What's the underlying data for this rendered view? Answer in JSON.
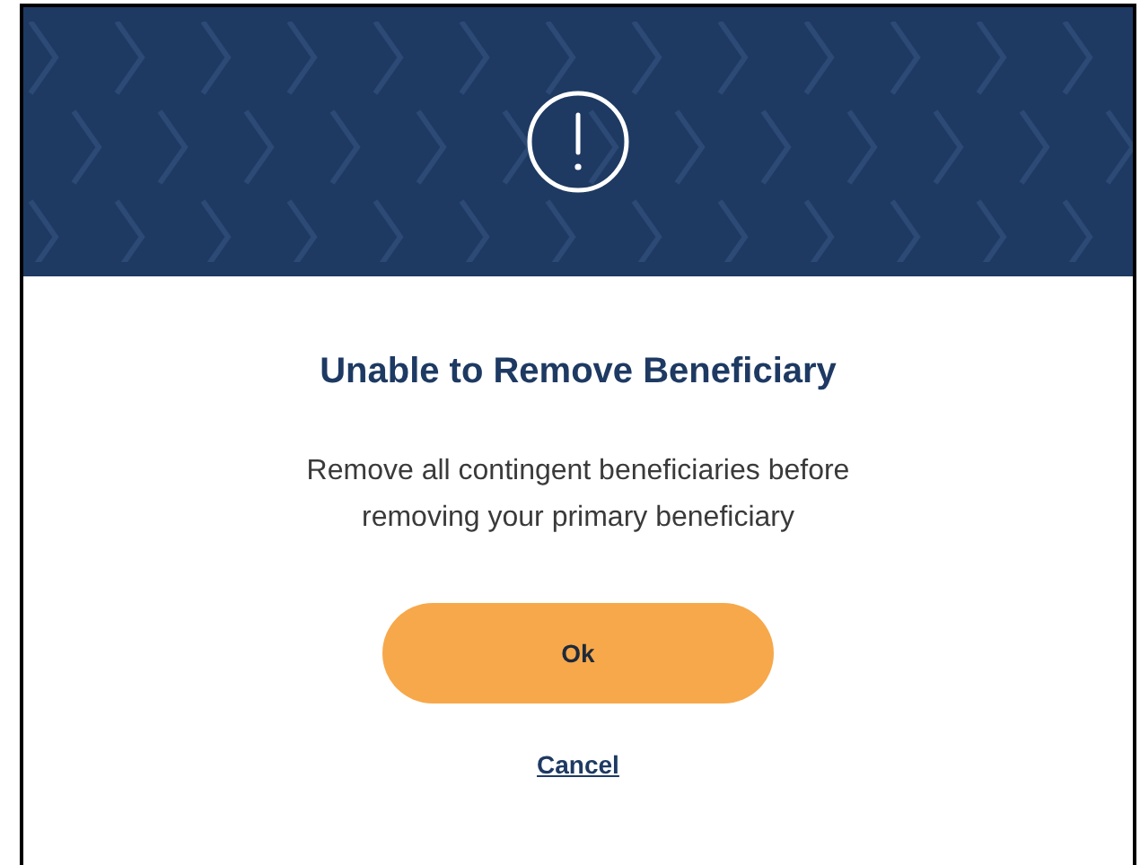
{
  "dialog": {
    "title": "Unable to Remove Beneficiary",
    "message": "Remove all contingent beneficiaries before removing your primary beneficiary",
    "buttons": [
      {
        "kind": "primary",
        "label": "Ok"
      },
      {
        "kind": "link",
        "label": "Cancel"
      }
    ]
  }
}
